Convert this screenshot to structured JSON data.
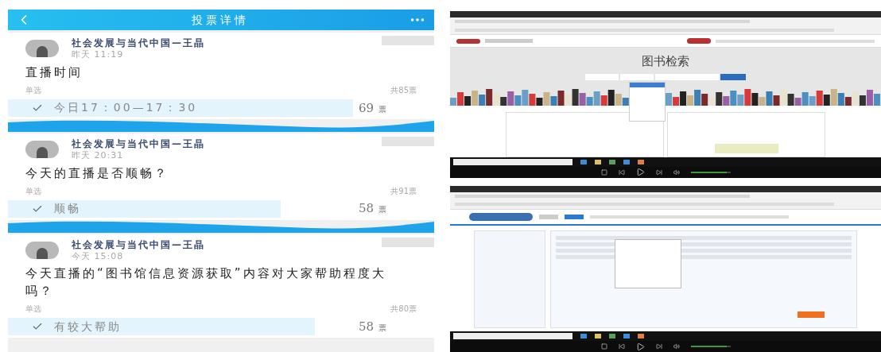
{
  "header": {
    "title": "投票详情"
  },
  "polls": [
    {
      "author": "社会发展与当代中国—王晶",
      "time": "昨天 11:19",
      "question": "直播时间",
      "mode": "单选",
      "total": "共85票",
      "options": [
        {
          "label": "今日17：00—17：30",
          "count": "69",
          "unit": "票",
          "checked": true,
          "level": 0.81
        }
      ]
    },
    {
      "author": "社会发展与当代中国—王晶",
      "time": "昨天 20:31",
      "question": "今天的直播是否顺畅？",
      "mode": "单选",
      "total": "共91票",
      "options": [
        {
          "label": "顺畅",
          "count": "58",
          "unit": "票",
          "checked": true,
          "level": 0.64
        }
      ]
    },
    {
      "author": "社会发展与当代中国—王晶",
      "time": "今天 15:08",
      "question": "今天直播的“图书馆信息资源获取”内容对大家帮助程度大吗？",
      "mode": "单选",
      "total": "共80票",
      "options": [
        {
          "label": "有较大帮助",
          "count": "58",
          "unit": "票",
          "checked": true,
          "level": 0.72
        }
      ]
    }
  ],
  "recordings": [
    {
      "kind": "library",
      "heading": "图书检索",
      "volume": {
        "level": 0.9
      }
    },
    {
      "kind": "cnki",
      "volume": {
        "level": 0.9
      }
    }
  ]
}
